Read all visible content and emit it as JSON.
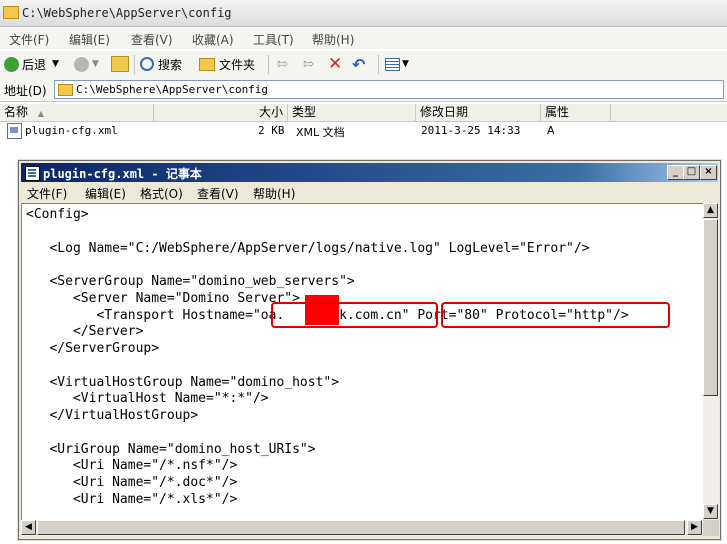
{
  "explorer": {
    "title": "C:\\WebSphere\\AppServer\\config",
    "menu": [
      "文件(F)",
      "编辑(E)",
      "查看(V)",
      "收藏(A)",
      "工具(T)",
      "帮助(H)"
    ],
    "toolbar": {
      "back": "后退",
      "search": "搜索",
      "folders": "文件夹"
    },
    "address_label": "地址(D)",
    "address_value": "C:\\WebSphere\\AppServer\\config",
    "columns": {
      "name": "名称",
      "size": "大小",
      "type": "类型",
      "modified": "修改日期",
      "attributes": "属性"
    },
    "files": [
      {
        "name": "plugin-cfg.xml",
        "size": "2 KB",
        "type": "XML 文档",
        "modified": "2011-3-25 14:33",
        "attributes": "A"
      }
    ]
  },
  "notepad": {
    "title": "plugin-cfg.xml - 记事本",
    "menu": [
      "文件(F)",
      "编辑(E)",
      "格式(O)",
      "查看(V)",
      "帮助(H)"
    ],
    "lines": [
      "<Config>",
      "",
      "   <Log Name=\"C:/WebSphere/AppServer/logs/native.log\" LogLevel=\"Error\"/>",
      "",
      "   <ServerGroup Name=\"domino_web_servers\">",
      "      <Server Name=\"Domino Server\">",
      "         <Transport Hostname=\"oa.     ank.com.cn\" Port=\"80\" Protocol=\"http\"/>",
      "      </Server>",
      "   </ServerGroup>",
      "",
      "   <VirtualHostGroup Name=\"domino_host\">",
      "      <VirtualHost Name=\"*:*\"/>",
      "   </VirtualHostGroup>",
      "",
      "   <UriGroup Name=\"domino_host_URIs\">",
      "      <Uri Name=\"/*.nsf*\"/>",
      "      <Uri Name=\"/*.doc*\"/>",
      "      <Uri Name=\"/*.xls*\"/>"
    ]
  },
  "colors": {
    "highlight": "#e00000",
    "titlebar": "#0a246a"
  }
}
